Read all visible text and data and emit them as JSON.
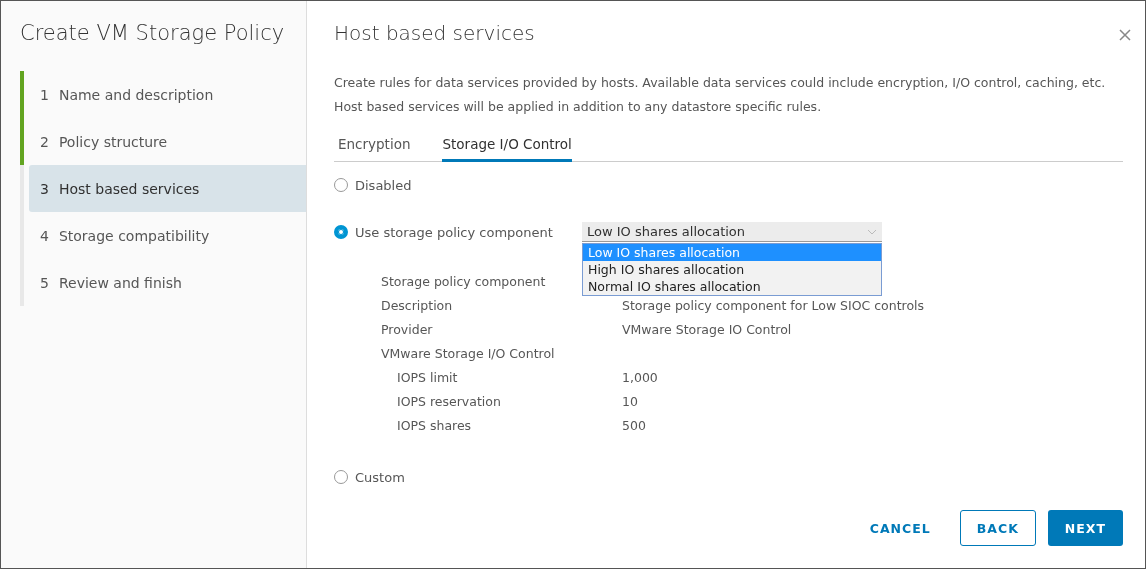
{
  "wizard": {
    "title": "Create VM Storage Policy",
    "steps": [
      {
        "number": "1",
        "label": "Name and description",
        "completed": true,
        "selected": false
      },
      {
        "number": "2",
        "label": "Policy structure",
        "completed": true,
        "selected": false
      },
      {
        "number": "3",
        "label": "Host based services",
        "completed": false,
        "selected": true
      },
      {
        "number": "4",
        "label": "Storage compatibility",
        "completed": false,
        "selected": false
      },
      {
        "number": "5",
        "label": "Review and finish",
        "completed": false,
        "selected": false
      }
    ]
  },
  "page": {
    "title": "Host based services",
    "description": [
      "Create rules for data services provided by hosts. Available data services could include encryption, I/O control, caching, etc.",
      "Host based services will be applied in addition to any datastore specific rules."
    ],
    "tabs": [
      {
        "label": "Encryption",
        "selected": false
      },
      {
        "label": "Storage I/O Control",
        "selected": true
      }
    ],
    "options": [
      {
        "label": "Disabled",
        "selected": false
      },
      {
        "label": "Use storage policy component",
        "selected": true,
        "dropdown": {
          "value": "Low IO shares allocation",
          "expanded": true,
          "options": [
            {
              "label": "Low IO shares allocation",
              "selected": true
            },
            {
              "label": "High IO shares allocation",
              "selected": false
            },
            {
              "label": "Normal IO shares allocation",
              "selected": false
            }
          ]
        },
        "details": [
          {
            "label": "Storage policy component"
          },
          {
            "label": "Description",
            "value": "Storage policy component for Low SIOC controls"
          },
          {
            "label": "Provider",
            "value": "VMware Storage IO Control"
          },
          {
            "label": "VMware Storage I/O Control"
          },
          {
            "label": "IOPS limit",
            "value": "1,000",
            "nested": true
          },
          {
            "label": "IOPS reservation",
            "value": "10",
            "nested": true
          },
          {
            "label": "IOPS shares",
            "value": "500",
            "nested": true
          }
        ]
      },
      {
        "label": "Custom",
        "selected": false
      }
    ],
    "buttons": [
      {
        "label": "CANCEL",
        "kind": "flat"
      },
      {
        "label": "BACK",
        "kind": "outline"
      },
      {
        "label": "NEXT",
        "kind": "primary"
      }
    ]
  }
}
